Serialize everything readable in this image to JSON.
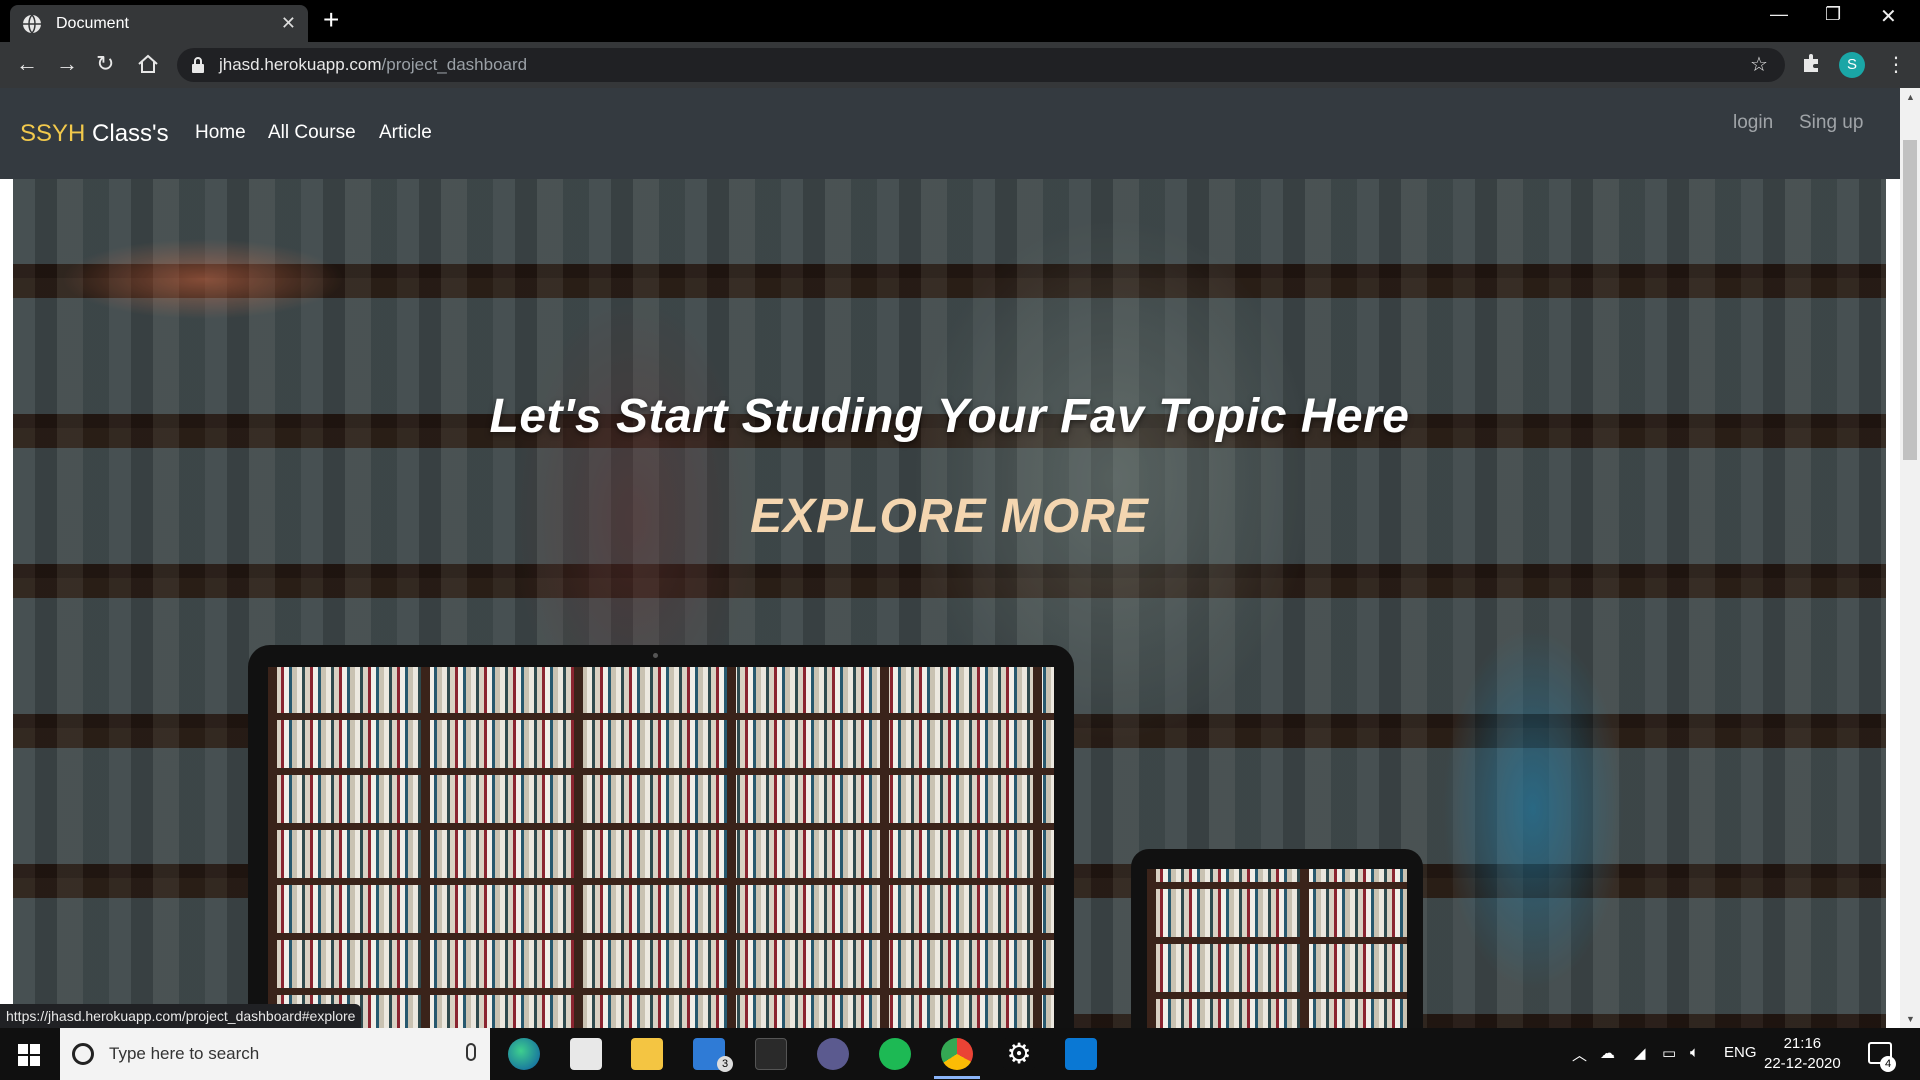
{
  "browser": {
    "tab_title": "Document",
    "tab_close": "✕",
    "new_tab": "+",
    "url_domain": "jhasd.herokuapp.com",
    "url_path": "/project_dashboard",
    "profile_initial": "S",
    "status_url": "https://jhasd.herokuapp.com/project_dashboard#explore"
  },
  "site": {
    "brand_accent": "SSYH",
    "brand_rest": " Class's",
    "nav": [
      "Home",
      "All Course",
      "Article"
    ],
    "auth": [
      "login",
      "Sing up"
    ],
    "accent_color": "#f2c94c",
    "navbar_color": "#343a40"
  },
  "hero": {
    "title": "Let's Start Studing Your Fav Topic Here",
    "cta": "EXPLORE MORE"
  },
  "taskbar": {
    "search_placeholder": "Type here to search",
    "mail_badge": "3",
    "language": "ENG",
    "time": "21:16",
    "date": "22-12-2020",
    "notification_count": "4"
  }
}
